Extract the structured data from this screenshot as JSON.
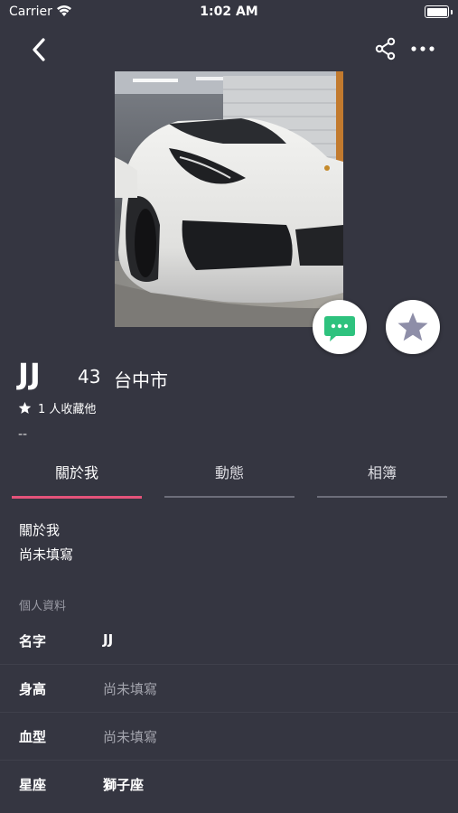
{
  "status_bar": {
    "carrier": "Carrier",
    "time": "1:02 AM"
  },
  "nav": {
    "back_icon": "chevron-left-icon",
    "share_icon": "share-icon",
    "more_icon": "more-horizontal-icon"
  },
  "profile": {
    "name": "JJ",
    "age": "43",
    "city": "台中市",
    "favorites_text": "1 人收藏他",
    "tagline": "--"
  },
  "actions": {
    "chat_icon": "chat-bubble-icon",
    "favorite_icon": "star-icon",
    "chat_color": "#2ec27e"
  },
  "tabs": [
    {
      "label": "關於我",
      "active": true
    },
    {
      "label": "動態",
      "active": false
    },
    {
      "label": "相簿",
      "active": false
    }
  ],
  "about": {
    "title": "關於我",
    "value": "尚未填寫"
  },
  "personal": {
    "section_label": "個人資料",
    "rows": [
      {
        "label": "名字",
        "value": "JJ"
      },
      {
        "label": "身高",
        "value": "尚未填寫"
      },
      {
        "label": "血型",
        "value": "尚未填寫"
      },
      {
        "label": "星座",
        "value": "獅子座"
      }
    ]
  },
  "colors": {
    "background": "#353641",
    "accent": "#e4537a",
    "tab_inactive_line": "#6d6e7a"
  }
}
